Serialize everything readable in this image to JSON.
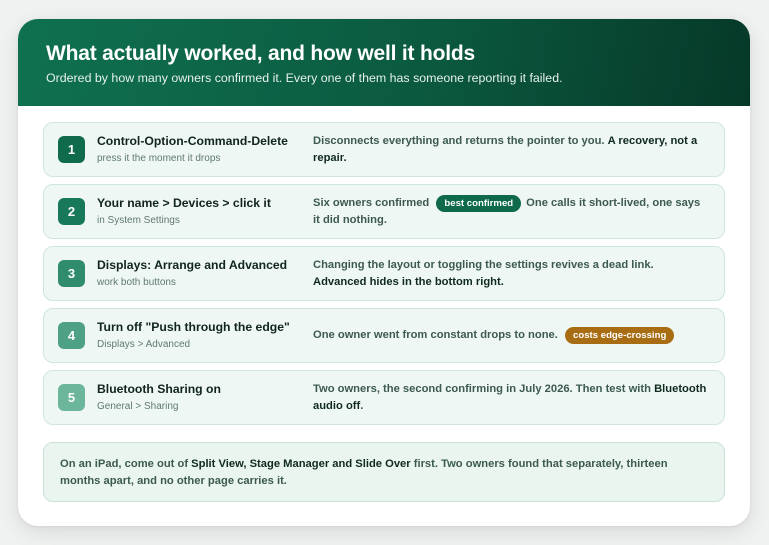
{
  "header": {
    "title": "What actually worked, and how well it holds",
    "subtitle": "Ordered by how many owners confirmed it. Every one of them has someone reporting it failed."
  },
  "rows": [
    {
      "number": "1",
      "color": "#0f6b4c",
      "title": "Control-Option-Command-Delete",
      "subtitle": "press it the moment it drops",
      "desc": {
        "text1": "Disconnects everything and returns the pointer to you. ",
        "bold1": "A recovery, not a repair."
      }
    },
    {
      "number": "2",
      "color": "#17795a",
      "title": "Your name > Devices > click it",
      "subtitle": "in System Settings",
      "desc": {
        "text1": "Six owners confirmed",
        "badge": "best confirmed",
        "badge_color": "#0e6a4b",
        "text2": "One calls it short-lived, one says it did nothing."
      }
    },
    {
      "number": "3",
      "color": "#2f8c6d",
      "title": "Displays: Arrange and Advanced",
      "subtitle": "work both buttons",
      "desc": {
        "text1": "Changing the layout or toggling the settings revives a dead link. ",
        "bold1": "Advanced hides in the bottom right."
      }
    },
    {
      "number": "4",
      "color": "#4ea184",
      "title": "Turn off \"Push through the edge\"",
      "subtitle": "Displays > Advanced",
      "desc": {
        "text1": "One owner went from constant drops to none.",
        "badge": "costs edge-crossing",
        "badge_color": "#a86d12"
      }
    },
    {
      "number": "5",
      "color": "#6cb69b",
      "title": "Bluetooth Sharing on",
      "subtitle": "General > Sharing",
      "desc": {
        "text1": "Two owners, the second confirming in July 2026. Then test with ",
        "bold1": "Bluetooth audio off",
        "text2": "."
      }
    }
  ],
  "note": {
    "text1": "On an iPad, come out of ",
    "bold1": "Split View, Stage Manager and Slide Over",
    "text2": " first. Two owners found that separately, thirteen months apart, and no other page carries it."
  }
}
